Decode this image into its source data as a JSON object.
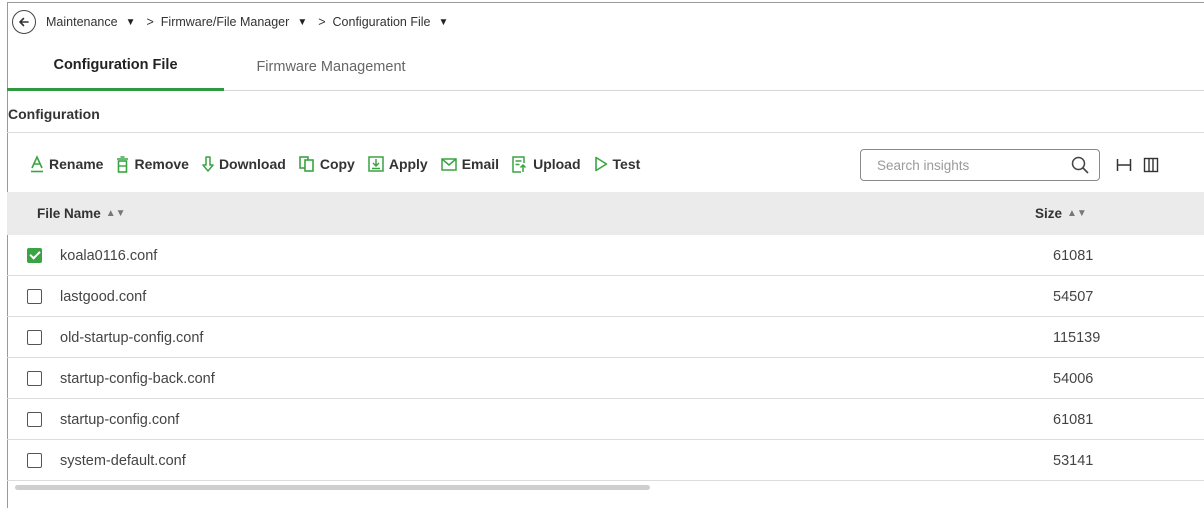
{
  "breadcrumb": {
    "items": [
      {
        "label": "Maintenance"
      },
      {
        "label": "Firmware/File Manager"
      },
      {
        "label": "Configuration File"
      }
    ],
    "separator": ">"
  },
  "tabs": [
    {
      "label": "Configuration File",
      "active": true
    },
    {
      "label": "Firmware Management",
      "active": false
    }
  ],
  "section": {
    "title": "Configuration"
  },
  "toolbar": {
    "rename": "Rename",
    "remove": "Remove",
    "download": "Download",
    "copy": "Copy",
    "apply": "Apply",
    "email": "Email",
    "upload": "Upload",
    "test": "Test"
  },
  "search": {
    "placeholder": "Search insights",
    "value": ""
  },
  "table": {
    "columns": [
      "File Name",
      "Size"
    ],
    "rows": [
      {
        "name": "koala0116.conf",
        "size": "61081",
        "checked": true
      },
      {
        "name": "lastgood.conf",
        "size": "54507",
        "checked": false
      },
      {
        "name": "old-startup-config.conf",
        "size": "115139",
        "checked": false
      },
      {
        "name": "startup-config-back.conf",
        "size": "54006",
        "checked": false
      },
      {
        "name": "startup-config.conf",
        "size": "61081",
        "checked": false
      },
      {
        "name": "system-default.conf",
        "size": "53141",
        "checked": false
      }
    ]
  },
  "colors": {
    "accent": "#3aa342",
    "header_bg": "#ebebeb"
  },
  "icons": [
    "back-arrow-icon",
    "rename-icon",
    "remove-icon",
    "download-icon",
    "copy-icon",
    "apply-icon",
    "email-icon",
    "upload-icon",
    "test-icon",
    "search-icon",
    "fit-columns-icon",
    "columns-icon"
  ]
}
